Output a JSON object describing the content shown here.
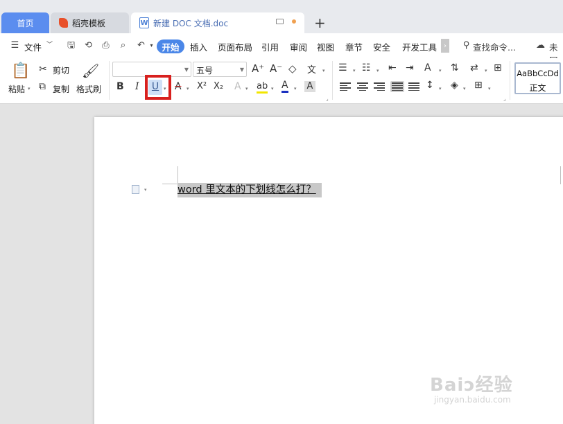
{
  "tabs": {
    "home": "首页",
    "docer": "稻壳模板",
    "document": "新建 DOC 文档.doc",
    "add": "+"
  },
  "menu": {
    "file": "文件",
    "start": "开始",
    "insert": "插入",
    "layout": "页面布局",
    "reference": "引用",
    "review": "审阅",
    "view": "视图",
    "chapter": "章节",
    "security": "安全",
    "devtools": "开发工具",
    "search": "查找命令...",
    "cloud": "未同"
  },
  "ribbon": {
    "paste": "粘贴",
    "cut": "剪切",
    "copy": "复制",
    "format_painter": "格式刷",
    "font_name": "",
    "font_size": "五号",
    "bold": "B",
    "italic": "I",
    "underline": "U",
    "superscript": "X²",
    "subscript": "X₂",
    "style_preview": "AaBbCcDd",
    "style_name": "正文"
  },
  "document": {
    "text": "word 里文本的下划线怎么打？"
  },
  "watermark": {
    "brand": "Baiↄ经验",
    "url": "jingyan.baidu.com"
  },
  "colors": {
    "accent": "#4b87e8",
    "highlight_box": "#d8201e",
    "tab_home": "#5b8def"
  }
}
